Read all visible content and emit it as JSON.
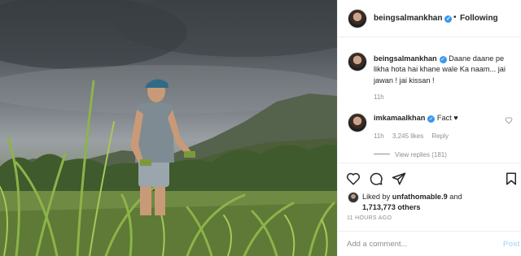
{
  "post": {
    "image_alt": "Man in grey t-shirt and cap standing in a green field under a cloudy sky",
    "colors": {
      "link_blue": "#3897f0",
      "muted": "#8e8e8e",
      "border": "#efefef"
    }
  },
  "header": {
    "username": "beingsalmankhan",
    "separator": "•",
    "follow_status": "Following"
  },
  "caption": {
    "username": "beingsalmankhan",
    "text": "Daane daane pe likha hota hai khane wale Ka naam... jai jawan ! jai kissan !",
    "time": "11h"
  },
  "comment": {
    "username": "imkamaalkhan",
    "text": "Fact ♥",
    "time": "11h",
    "likes": "3,245 likes",
    "reply": "Reply",
    "view_replies": "View replies (181)"
  },
  "actions": {
    "like_icon": "heart-icon",
    "comment_icon": "comment-icon",
    "share_icon": "share-icon",
    "save_icon": "bookmark-icon"
  },
  "likes": {
    "prefix": "Liked by ",
    "first_user": "unfathomable.9",
    "middle": " and",
    "count": "1,713,773 others"
  },
  "timestamp": "11 HOURS AGO",
  "add_comment": {
    "placeholder": "Add a comment...",
    "post_label": "Post"
  }
}
